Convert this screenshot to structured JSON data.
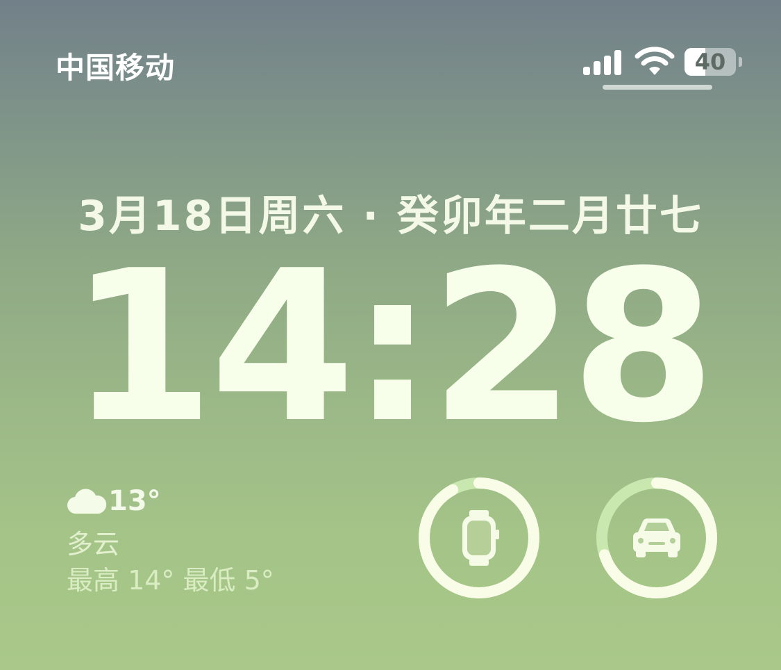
{
  "status_bar": {
    "carrier": "中国移动",
    "signal_icon": "cellular-signal-icon",
    "wifi_icon": "wifi-icon",
    "battery_level": "40",
    "battery_fraction": 0.4
  },
  "lock_screen": {
    "date": "3月18日周六 · 癸卯年二月廿七",
    "time": "14:28"
  },
  "weather_widget": {
    "icon": "cloud-icon",
    "temperature": "13°",
    "condition": "多云",
    "range": "最高 14° 最低 5°"
  },
  "battery_widgets": [
    {
      "device": "apple-watch-icon",
      "charge_fraction": 0.92
    },
    {
      "device": "car-icon",
      "charge_fraction": 0.7
    }
  ],
  "colors": {
    "gradient_top": "#728089",
    "gradient_bottom": "#a9c889",
    "text_primary": "#f7feea",
    "ring_track": "#c8e8b0",
    "ring_fill": "#f9fde8"
  }
}
